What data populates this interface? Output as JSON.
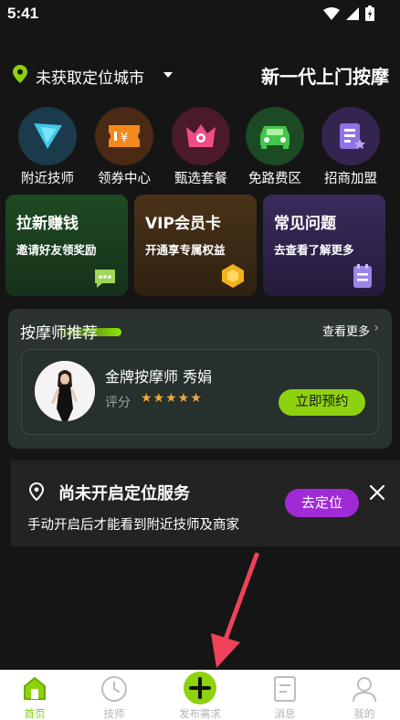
{
  "status_bar": {
    "time": "5:41"
  },
  "location": {
    "city": "未获取定位城市",
    "slogan": "新一代上门按摩"
  },
  "quick_nav": [
    {
      "label": "附近技师",
      "icon": "play-icon",
      "bg": "#1b3a4c"
    },
    {
      "label": "领券中心",
      "icon": "coupon-icon",
      "bg": "#4a2a14"
    },
    {
      "label": "甄选套餐",
      "icon": "crown-icon",
      "bg": "#4a1a2c"
    },
    {
      "label": "免路费区",
      "icon": "car-icon",
      "bg": "#1c4a24"
    },
    {
      "label": "招商加盟",
      "icon": "document-star-icon",
      "bg": "#342550"
    }
  ],
  "promos": [
    {
      "title": "拉新赚钱",
      "subtitle": "邀请好友领奖励",
      "icon": "chat-bubble-icon"
    },
    {
      "title": "VIP会员卡",
      "subtitle": "开通享专属权益",
      "icon": "vip-badge-icon"
    },
    {
      "title": "常见问题",
      "subtitle": "去查看了解更多",
      "icon": "notebook-icon"
    }
  ],
  "recommend": {
    "title": "按摩师推荐",
    "more": "查看更多",
    "technician": {
      "name": "金牌按摩师 秀娟",
      "rating_label": "评分",
      "stars": "★★★★★",
      "rating": 5,
      "book": "立即预约"
    }
  },
  "location_banner": {
    "title": "尚未开启定位服务",
    "text": "手动开启后才能看到附近技师及商家",
    "button": "去定位"
  },
  "tabs": [
    {
      "label": "首页",
      "icon": "home-icon",
      "active": true
    },
    {
      "label": "技师",
      "icon": "clock-icon",
      "active": false
    },
    {
      "label": "发布需求",
      "icon": "plus-icon",
      "active": false
    },
    {
      "label": "消息",
      "icon": "message-icon",
      "active": false
    },
    {
      "label": "我的",
      "icon": "profile-icon",
      "active": false
    }
  ],
  "colors": {
    "accent": "#8ed10f",
    "locate_button": "#a02bd6",
    "star": "#f2a83b",
    "background": "#151515"
  }
}
